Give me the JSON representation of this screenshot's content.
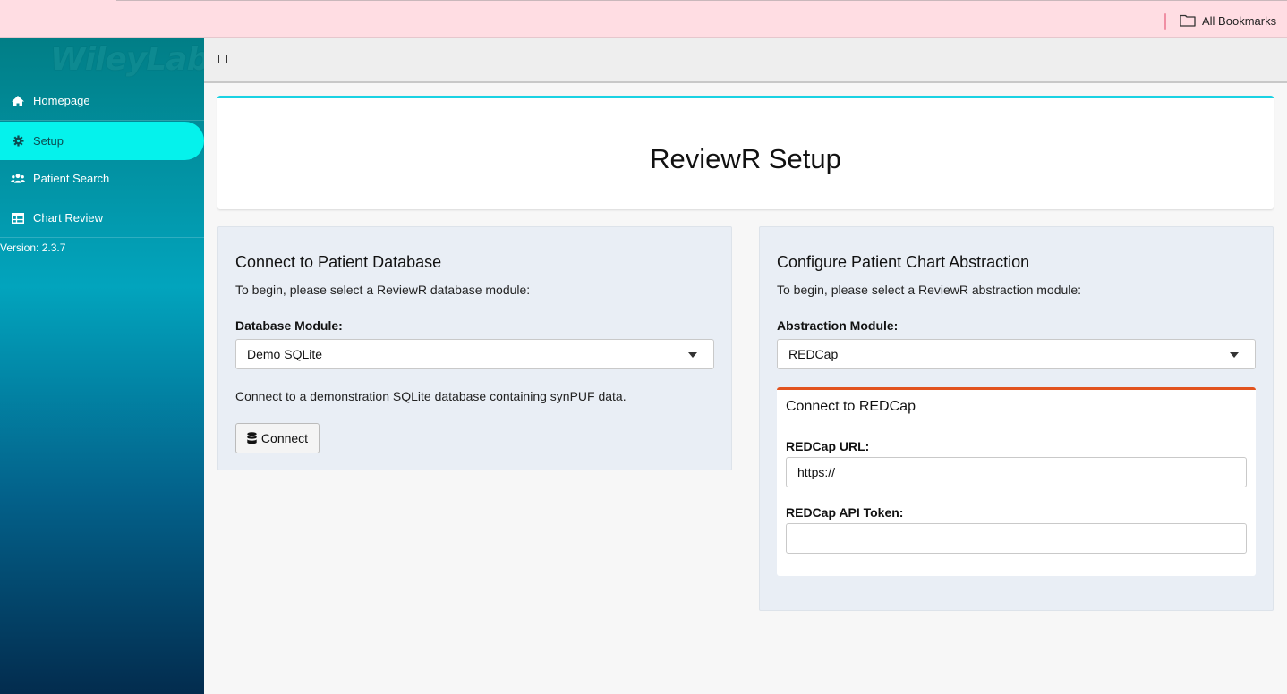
{
  "browser": {
    "bookmarks_label": "All Bookmarks",
    "folder_icon": "folder-icon"
  },
  "sidebar": {
    "logo_text": "WileyLab",
    "items": [
      {
        "label": "Homepage",
        "icon": "home-icon"
      },
      {
        "label": "Setup",
        "icon": "gear-icon",
        "active": true
      },
      {
        "label": "Patient Search",
        "icon": "users-icon"
      },
      {
        "label": "Chart Review",
        "icon": "table-icon"
      }
    ],
    "version": "Version: 2.3.7"
  },
  "main": {
    "title": "ReviewR Setup",
    "database_panel": {
      "heading": "Connect to Patient Database",
      "intro": "To begin, please select a ReviewR database module:",
      "field_label": "Database Module:",
      "selected": "Demo SQLite",
      "description": "Connect to a demonstration SQLite database containing synPUF data.",
      "connect_label": "Connect"
    },
    "abstraction_panel": {
      "heading": "Configure Patient Chart Abstraction",
      "intro": "To begin, please select a ReviewR abstraction module:",
      "field_label": "Abstraction Module:",
      "selected": "REDCap",
      "redcap": {
        "heading": "Connect to REDCap",
        "url_label": "REDCap URL:",
        "url_value": "https://",
        "token_label": "REDCap API Token:",
        "token_value": ""
      }
    }
  },
  "colors": {
    "active_nav": "#05f2ec",
    "title_accent": "#1ad2e3",
    "redcap_accent": "#e2531e"
  }
}
